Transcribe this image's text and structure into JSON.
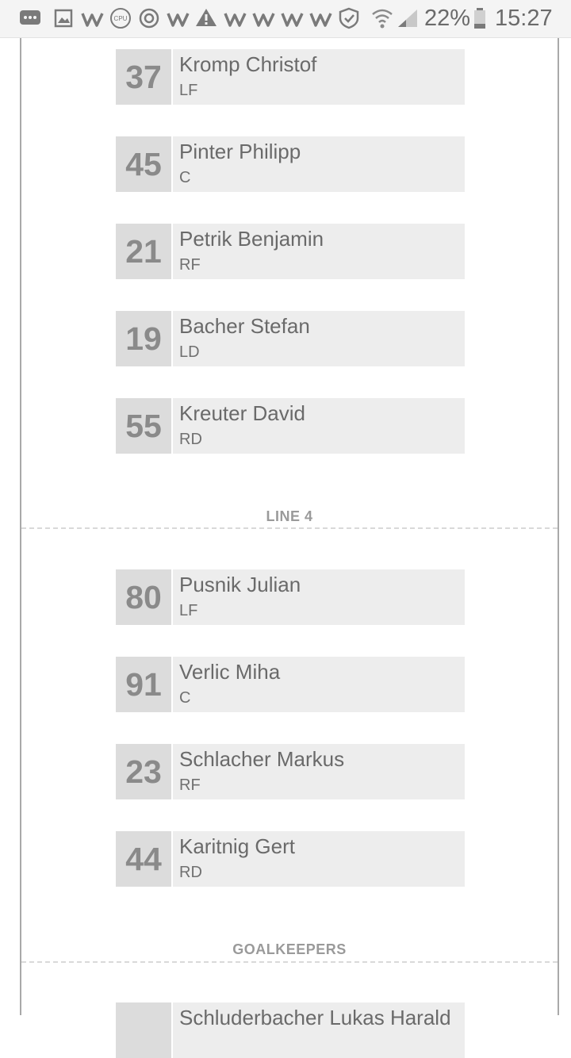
{
  "status_bar": {
    "battery": "22%",
    "time": "15:27",
    "icons": [
      "message-icon",
      "image-icon",
      "w-app-icon",
      "cpu-icon",
      "sync-icon",
      "w-app-icon",
      "warning-icon",
      "w-app-icon",
      "w-app-icon",
      "w-app-icon",
      "w-app-icon",
      "shield-check-icon",
      "wifi-icon",
      "signal-icon",
      "battery-icon"
    ]
  },
  "line3": [
    {
      "number": "37",
      "name": "Kromp Christof",
      "position": "LF"
    },
    {
      "number": "45",
      "name": "Pinter Philipp",
      "position": "C"
    },
    {
      "number": "21",
      "name": "Petrik Benjamin",
      "position": "RF"
    },
    {
      "number": "19",
      "name": "Bacher Stefan",
      "position": "LD"
    },
    {
      "number": "55",
      "name": "Kreuter David",
      "position": "RD"
    }
  ],
  "line4": {
    "title": "LINE 4",
    "players": [
      {
        "number": "80",
        "name": "Pusnik Julian",
        "position": "LF"
      },
      {
        "number": "91",
        "name": "Verlic Miha",
        "position": "C"
      },
      {
        "number": "23",
        "name": "Schlacher Markus",
        "position": "RF"
      },
      {
        "number": "44",
        "name": "Karitnig Gert",
        "position": "RD"
      }
    ]
  },
  "goalkeepers": {
    "title": "GOALKEEPERS",
    "players": [
      {
        "number": "",
        "name": "Schluderbacher Lukas Harald",
        "position": ""
      }
    ]
  }
}
